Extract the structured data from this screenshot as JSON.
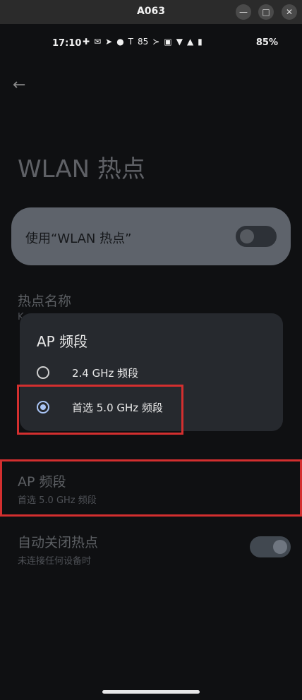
{
  "window": {
    "title": "A063"
  },
  "status": {
    "time": "17:10",
    "battery": "85%",
    "icons": [
      "✚",
      "✉",
      "➤",
      "●",
      "T",
      "85",
      "≻",
      "▣",
      "▼",
      "▲",
      "▮"
    ]
  },
  "page": {
    "title": "WLAN 热点"
  },
  "master_switch": {
    "label": "使用“WLAN 热点”",
    "on": false
  },
  "hotspot_name": {
    "title": "热点名称",
    "value": "K"
  },
  "ap_band": {
    "title": "AP 频段",
    "value": "首选 5.0 GHz 频段"
  },
  "auto_off": {
    "title": "自动关闭热点",
    "subtitle": "未连接任何设备时",
    "on": true
  },
  "dialog": {
    "title": "AP 频段",
    "options": [
      {
        "label": "2.4 GHz 频段",
        "selected": false
      },
      {
        "label": "首选 5.0 GHz 频段",
        "selected": true
      }
    ]
  },
  "highlight_color": "#d32f2f"
}
